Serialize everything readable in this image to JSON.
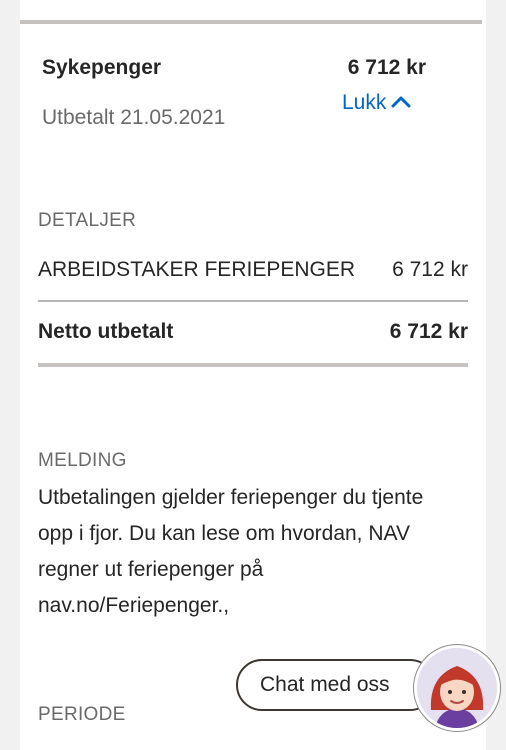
{
  "payment": {
    "title": "Sykepenger",
    "amount": "6 712 kr",
    "date": "Utbetalt 21.05.2021",
    "toggle_label": "Lukk"
  },
  "details": {
    "heading": "DETALJER",
    "line_label": "ARBEIDSTAKER FERIEPENGER",
    "line_amount": "6 712 kr",
    "net_label": "Netto utbetalt",
    "net_amount": "6 712 kr"
  },
  "message": {
    "heading": "MELDING",
    "text": "Utbetalingen gjelder feriepenger du tjente opp i fjor. Du kan lese om hvordan, NAV regner ut feriepenger på nav.no/Feriepenger.,"
  },
  "period": {
    "heading": "PERIODE"
  },
  "chat": {
    "label": "Chat med oss"
  },
  "colors": {
    "link": "#0067c5",
    "rule": "#c6c2bf",
    "muted": "#6a6a6a"
  },
  "icons": {
    "toggle": "chevron-up-icon",
    "chat": "chat-avatar"
  }
}
